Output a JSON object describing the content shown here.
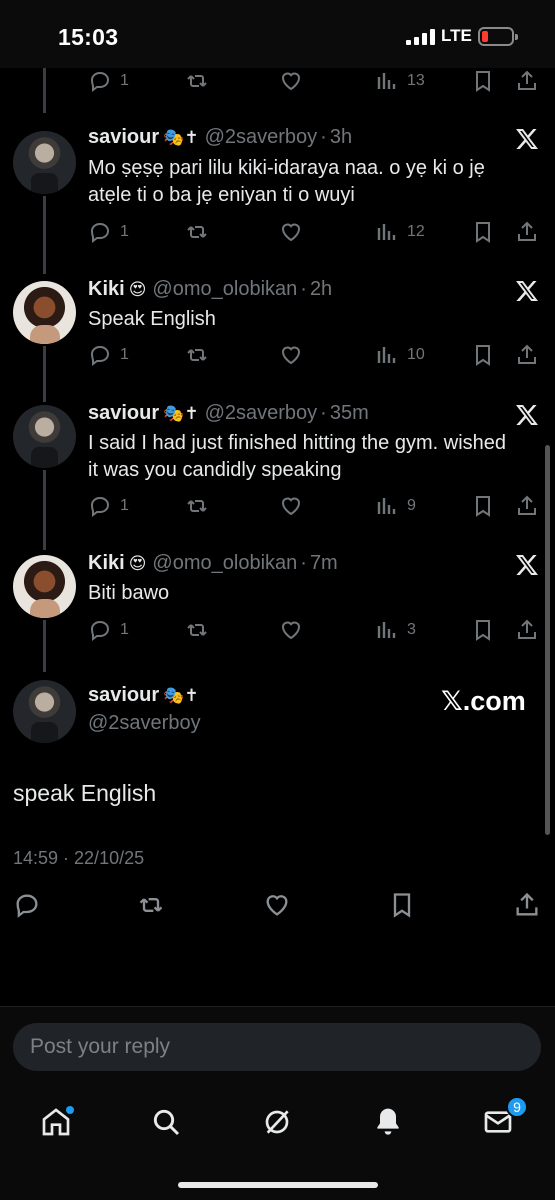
{
  "status_bar": {
    "time": "15:03",
    "network": "LTE"
  },
  "thread": [
    {
      "name": "saviour",
      "badge": "🎭✝",
      "handle": "@2saverboy",
      "time": "3h",
      "text": "Mo ṣẹṣẹ pari lilu kiki-idaraya naa. o yẹ ki o jẹ atẹle ti o ba jẹ eniyan ti o wuyi",
      "replies": "1",
      "views": "12"
    },
    {
      "name": "Kiki",
      "badge": "😍",
      "handle": "@omo_olobikan",
      "time": "2h",
      "text": "Speak English",
      "replies": "1",
      "views": "10"
    },
    {
      "name": "saviour",
      "badge": "🎭✝",
      "handle": "@2saverboy",
      "time": "35m",
      "text": "I said I had just finished hitting the gym. wished it was you candidly speaking",
      "replies": "1",
      "views": "9"
    },
    {
      "name": "Kiki",
      "badge": "😍",
      "handle": "@omo_olobikan",
      "time": "7m",
      "text": "Biti bawo",
      "replies": "1",
      "views": "3"
    }
  ],
  "top_partial": {
    "replies": "1",
    "views": "13"
  },
  "focused_post": {
    "name": "saviour",
    "badge": "🎭✝",
    "handle": "@2saverboy",
    "watermark": "𝕏.com",
    "text": "speak English",
    "timestamp": "14:59 · 22/10/25"
  },
  "reply": {
    "placeholder": "Post your reply"
  },
  "nav": {
    "messages_badge": "9"
  }
}
